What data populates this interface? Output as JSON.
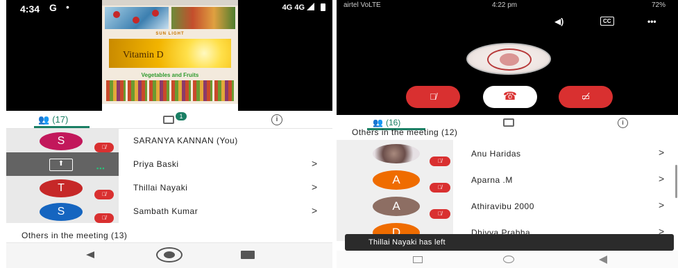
{
  "left": {
    "status": {
      "time": "4:34",
      "network": "4G 4G"
    },
    "shared": {
      "sunlight": "SUN LIGHT",
      "vitamin": "Vitamin D",
      "vegetables_title": "Vegetables and Fruits"
    },
    "tabs": {
      "people_count": "(17)",
      "chat_badge": "1"
    },
    "participants": [
      {
        "initial": "S",
        "name": "SARANYA KANNAN (You)",
        "color": "#c2185b"
      },
      {
        "initial": "",
        "name": "Priya Baski",
        "color": "#636363"
      },
      {
        "initial": "T",
        "name": "Thillai Nayaki",
        "color": "#c62828"
      },
      {
        "initial": "S",
        "name": "Sambath Kumar",
        "color": "#1565c0"
      }
    ],
    "others_label": "Others in the meeting (13)",
    "chevron": ">"
  },
  "right": {
    "status": {
      "carrier": "airtel VoLTE",
      "time": "4:22 pm",
      "battery": "72%"
    },
    "tabs": {
      "people_count": "(16)"
    },
    "others_label": "Others in the meeting (12)",
    "participants": [
      {
        "initial": "",
        "name": "Anu Haridas",
        "color": ""
      },
      {
        "initial": "A",
        "name": "Aparna .M",
        "color": "#ef6c00"
      },
      {
        "initial": "A",
        "name": "Athiravibu 2000",
        "color": "#8d6e63"
      },
      {
        "initial": "D",
        "name": "Dhivya Prabha",
        "color": "#ef6c00"
      }
    ],
    "toast": "Thillai Nayaki has left",
    "chevron": ">"
  },
  "colors": {
    "accent": "#1a7f64",
    "muted": "#d93030"
  }
}
